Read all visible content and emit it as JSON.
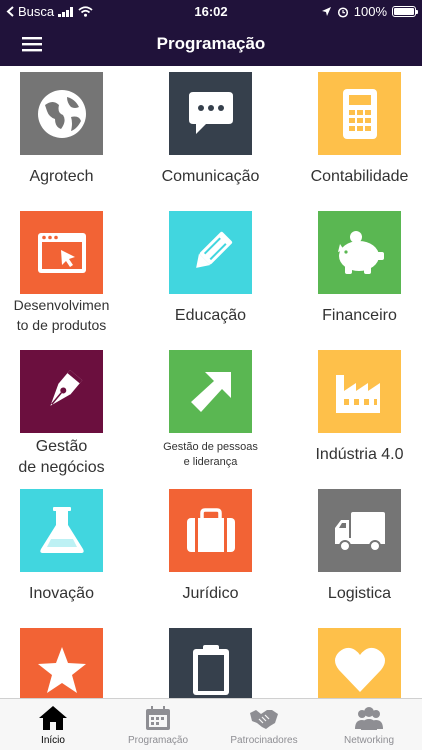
{
  "status": {
    "carrier": "Busca",
    "time": "16:02",
    "battery": "100%",
    "battery_level": 1.0
  },
  "nav": {
    "title": "Programação",
    "menu_icon": "hamburger-menu-icon"
  },
  "categories": [
    {
      "label": "Agrotech",
      "icon": "globe-icon",
      "color": "#757575"
    },
    {
      "label": "Comunicação",
      "icon": "chat-bubble-icon",
      "color": "#36404c"
    },
    {
      "label": "Contabilidade",
      "icon": "calculator-icon",
      "color": "#fec04a"
    },
    {
      "label": "Desenvolvimen to de produtos",
      "label_line1": "Desenvolvimen",
      "label_line2": "to de produtos",
      "icon": "browser-cursor-icon",
      "color": "#f26335"
    },
    {
      "label": "Educação",
      "icon": "pencil-icon",
      "color": "#41d6df"
    },
    {
      "label": "Financeiro",
      "icon": "piggy-bank-icon",
      "color": "#5ab752"
    },
    {
      "label": "Gestão de negócios",
      "label_line1": "Gestão",
      "label_line2": "de negócios",
      "icon": "fountain-pen-icon",
      "color": "#6b0f3e"
    },
    {
      "label": "Gestão de pessoas e liderança",
      "label_line1": "Gestão de pessoas",
      "label_line2": "e liderança",
      "icon": "arrow-up-right-icon",
      "color": "#5ab752"
    },
    {
      "label": "Indústria 4.0",
      "icon": "factory-icon",
      "color": "#fec04a"
    },
    {
      "label": "Inovação",
      "icon": "flask-icon",
      "color": "#41d6df"
    },
    {
      "label": "Jurídico",
      "icon": "briefcase-icon",
      "color": "#f26335"
    },
    {
      "label": "Logistica",
      "icon": "truck-icon",
      "color": "#757575"
    },
    {
      "label": "",
      "icon": "star-icon",
      "color": "#f26335"
    },
    {
      "label": "",
      "icon": "clipboard-icon",
      "color": "#36404c"
    },
    {
      "label": "",
      "icon": "heart-icon",
      "color": "#fec04a"
    }
  ],
  "tabs": [
    {
      "label": "Início",
      "icon": "home-icon",
      "active": true
    },
    {
      "label": "Programação",
      "icon": "calendar-icon",
      "active": false
    },
    {
      "label": "Patrocinadores",
      "icon": "handshake-icon",
      "active": false
    },
    {
      "label": "Networking",
      "icon": "people-icon",
      "active": false
    }
  ]
}
